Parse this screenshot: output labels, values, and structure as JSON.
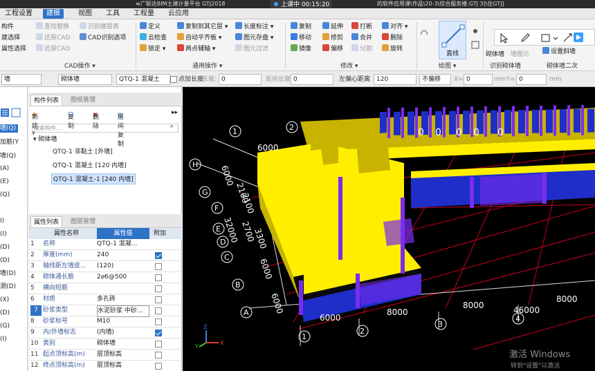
{
  "titlebar": {
    "app_title": "≡广联达BIM土建计量平台 GTJ2018",
    "file_title": "的软件应用课\\作品\\20-3\\综合服务楼.GTJ  3]\\住GTJ]"
  },
  "recording": {
    "label": "上课中 00:15:20"
  },
  "menu": {
    "items": [
      "工程设置",
      "建模",
      "视图",
      "工具",
      "工程量",
      "云应用"
    ],
    "active_index": 1
  },
  "ribbon": {
    "col1": [
      "构件",
      "建选择",
      "属性选择"
    ],
    "col2": [
      "查找替换",
      "还原CAD",
      "还原CAD"
    ],
    "col3": [
      "识别楼层表",
      "CAD识别选项"
    ],
    "col4": [
      "定义",
      "云检查",
      "锁定 ▾"
    ],
    "col5": [
      "复制到其它层 ▾",
      "自动平齐板 ▾",
      "两点辅轴 ▾"
    ],
    "col6": [
      "长度标注 ▾",
      "图元存盘 ▾",
      "图元过滤"
    ],
    "col7": [
      "复制",
      "移动",
      "镜像"
    ],
    "col8": [
      "延伸",
      "修剪",
      "偏移"
    ],
    "col9": [
      "打断",
      "合并",
      "分割"
    ],
    "col10": [
      "对齐 ▾",
      "删除",
      "旋转"
    ],
    "big_button": "直线",
    "right1": [
      "砌体墙",
      "墙图元"
    ],
    "right2": [
      "设置斜墙"
    ],
    "groups": [
      "CAD操作 ▾",
      "通用操作 ▾",
      "修改 ▾",
      "绘图 ▾",
      "识别砌体墙",
      "砌体墙二次"
    ]
  },
  "propbar": {
    "floor": "墙",
    "type": "砌体墙",
    "component": "QTQ-1  混凝土",
    "point_length_label": "点加长度",
    "length_value": "0",
    "reverse_label": "反向长度",
    "reverse_value": "0",
    "offset_label": "左偏心距离",
    "offset_value": "120",
    "mode": "不偏移",
    "x_label": "X=",
    "x_value": "0",
    "mm1": "mmY=",
    "y_value": "0",
    "mm2": "mm"
  },
  "left_strip": [
    "墙(Q)",
    "加筋(Y",
    "墙(Q)",
    "(A)",
    "(E)",
    "(Q)",
    "I)",
    "(I)",
    "(D)",
    "(D)",
    "墙(D)",
    "洞(D)",
    "(X)",
    "(D)",
    "(G)",
    "(I)"
  ],
  "component_panel": {
    "tabs": [
      "构件列表",
      "图纸管理"
    ],
    "toolbar": [
      "新建 ▾",
      "复制",
      "删除",
      "层间复制"
    ],
    "search_placeholder": "搜索构件...",
    "group": "砌体墙",
    "items": [
      "QTQ-1  非黏土 [外墙]",
      "QTQ-1  混凝土 [120 内墙]",
      "QTQ-1  混凝土-1 [240 内墙]"
    ],
    "selected_index": 2
  },
  "property_panel": {
    "tabs": [
      "属性列表",
      "图层管理"
    ],
    "headers": [
      "属性名称",
      "属性值",
      "附加"
    ],
    "rows": [
      {
        "n": "1",
        "name": "名称",
        "value": "QTQ-1  混凝...",
        "checked": false,
        "show_cb": false
      },
      {
        "n": "2",
        "name": "厚度(mm)",
        "value": "240",
        "checked": true,
        "show_cb": true
      },
      {
        "n": "3",
        "name": "轴线距左墙皮...",
        "value": "(120)",
        "checked": false,
        "show_cb": true
      },
      {
        "n": "4",
        "name": "砌体通长筋",
        "value": "2⌀6@500",
        "checked": false,
        "show_cb": true
      },
      {
        "n": "5",
        "name": "横向短筋",
        "value": "",
        "checked": false,
        "show_cb": true
      },
      {
        "n": "6",
        "name": "材质",
        "value": "多孔砖",
        "checked": false,
        "show_cb": true
      },
      {
        "n": "7",
        "name": "砂浆类型",
        "value": "水泥砂浆 中砂...",
        "checked": false,
        "show_cb": true
      },
      {
        "n": "8",
        "name": "砂浆标号",
        "value": "M10",
        "checked": false,
        "show_cb": true
      },
      {
        "n": "9",
        "name": "内/外墙标志",
        "value": "(内墙)",
        "checked": true,
        "show_cb": true
      },
      {
        "n": "10",
        "name": "类别",
        "value": "砌体墙",
        "checked": false,
        "show_cb": true
      },
      {
        "n": "11",
        "name": "起点顶标高(m)",
        "value": "层顶标高",
        "checked": false,
        "show_cb": true
      },
      {
        "n": "12",
        "name": "终点顶标高(m)",
        "value": "层顶标高",
        "checked": false,
        "show_cb": true
      }
    ]
  },
  "viewport": {
    "axis_numbers_front": [
      "1",
      "2",
      "3",
      "4"
    ],
    "axis_numbers_back": [
      "1",
      "2"
    ],
    "axis_letters": [
      "H",
      "G",
      "F",
      "E",
      "D",
      "C",
      "B",
      "A"
    ],
    "dims_front": [
      "6000",
      "8000",
      "8000",
      "46000",
      "8000"
    ],
    "dims_side": [
      "6000",
      "2100",
      "2100",
      "32000",
      "2700",
      "3300",
      "6000",
      "6000"
    ],
    "dim_top": "6000",
    "window_labels": [
      "0",
      "0",
      "0",
      "0",
      "0"
    ],
    "axis_x": "X",
    "axis_y": "Y",
    "axis_z": "Z"
  },
  "watermark": {
    "line1": "激活 Windows",
    "line2": "转到\"设置\"以激活 Windows。"
  },
  "colors": {
    "accent": "#2f73c8",
    "wall": "#ffee00",
    "wall_side": "#c8b400",
    "purple": "#7b2cf0",
    "blue": "#1f2ec8",
    "red_grid": "#c8001e"
  }
}
